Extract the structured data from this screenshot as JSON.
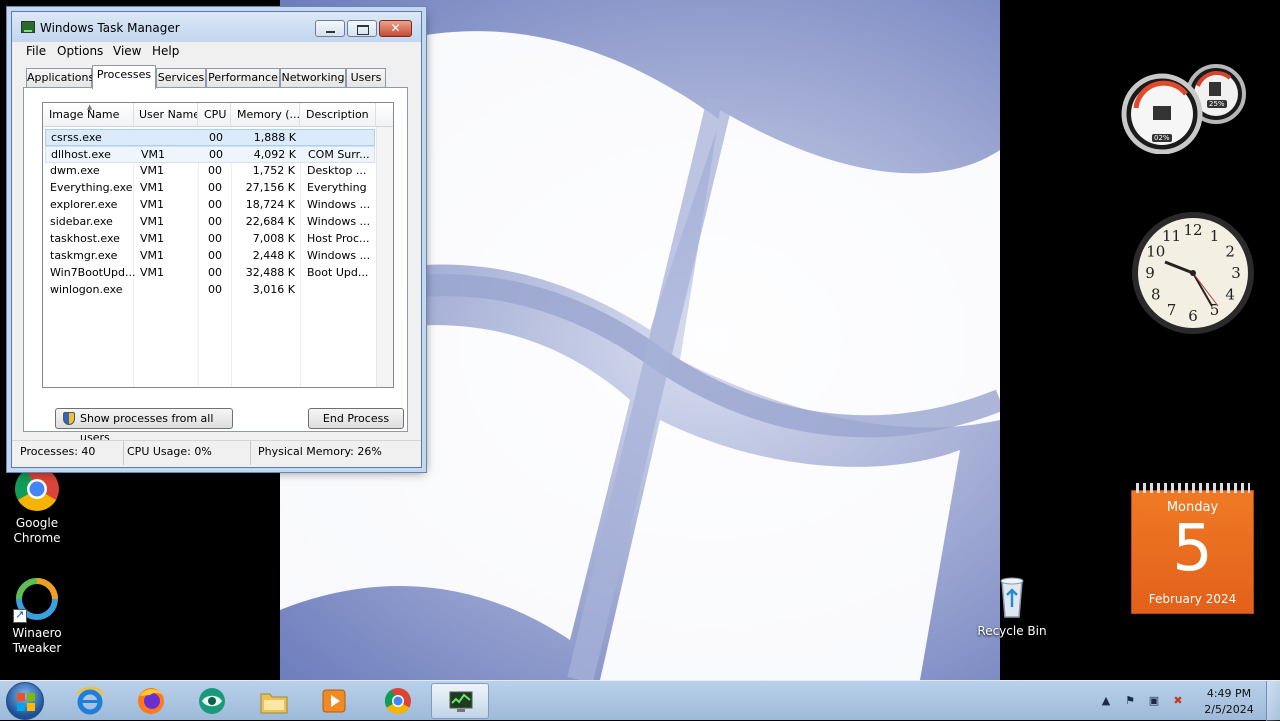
{
  "window": {
    "title": "Windows Task Manager",
    "menu": [
      "File",
      "Options",
      "View",
      "Help"
    ],
    "tabs": [
      "Applications",
      "Processes",
      "Services",
      "Performance",
      "Networking",
      "Users"
    ],
    "active_tab": "Processes"
  },
  "processes": {
    "columns": [
      "Image Name",
      "User Name",
      "CPU",
      "Memory (...",
      "Description"
    ],
    "rows": [
      {
        "name": "csrss.exe",
        "user": "",
        "cpu": "00",
        "memory": "1,888 K",
        "description": ""
      },
      {
        "name": "dllhost.exe",
        "user": "VM1",
        "cpu": "00",
        "memory": "4,092 K",
        "description": "COM Surr..."
      },
      {
        "name": "dwm.exe",
        "user": "VM1",
        "cpu": "00",
        "memory": "1,752 K",
        "description": "Desktop ..."
      },
      {
        "name": "Everything.exe",
        "user": "VM1",
        "cpu": "00",
        "memory": "27,156 K",
        "description": "Everything"
      },
      {
        "name": "explorer.exe",
        "user": "VM1",
        "cpu": "00",
        "memory": "18,724 K",
        "description": "Windows ..."
      },
      {
        "name": "sidebar.exe",
        "user": "VM1",
        "cpu": "00",
        "memory": "22,684 K",
        "description": "Windows ..."
      },
      {
        "name": "taskhost.exe",
        "user": "VM1",
        "cpu": "00",
        "memory": "7,008 K",
        "description": "Host Proc..."
      },
      {
        "name": "taskmgr.exe",
        "user": "VM1",
        "cpu": "00",
        "memory": "2,448 K",
        "description": "Windows ..."
      },
      {
        "name": "Win7BootUpd...",
        "user": "VM1",
        "cpu": "00",
        "memory": "32,488 K",
        "description": "Boot Upd..."
      },
      {
        "name": "winlogon.exe",
        "user": "",
        "cpu": "00",
        "memory": "3,016 K",
        "description": ""
      }
    ],
    "show_all_label": "Show processes from all users",
    "end_process_label": "End Process"
  },
  "status": {
    "processes": "Processes: 40",
    "cpu": "CPU Usage: 0%",
    "memory": "Physical Memory: 26%"
  },
  "desktop": {
    "icons": [
      {
        "label": "Google Chrome",
        "icon": "chrome-icon"
      },
      {
        "label": "Winaero Tweaker",
        "icon": "winaero-icon"
      },
      {
        "label": "Recycle Bin",
        "icon": "recycle-bin-icon"
      }
    ]
  },
  "gadgets": {
    "cpu_meter": {
      "cpu": "02%",
      "memory": "25%"
    },
    "calendar": {
      "day_name": "Monday",
      "day": "5",
      "month_year": "February 2024"
    },
    "clock": {
      "numerals": [
        "12",
        "1",
        "2",
        "3",
        "4",
        "5",
        "6",
        "7",
        "8",
        "9",
        "10",
        "11"
      ]
    }
  },
  "taskbar": {
    "items": [
      {
        "icon": "internet-explorer-icon"
      },
      {
        "icon": "firefox-icon"
      },
      {
        "icon": "app-icon"
      },
      {
        "icon": "file-explorer-icon"
      },
      {
        "icon": "media-player-icon"
      },
      {
        "icon": "chrome-icon"
      },
      {
        "icon": "task-manager-icon",
        "active": true
      }
    ],
    "clock_time": "4:49 PM",
    "clock_date": "2/5/2024"
  },
  "colors": {
    "calendar": "#e86a20",
    "selection": "#dcebfc",
    "taskbar": "#aec8e4"
  }
}
